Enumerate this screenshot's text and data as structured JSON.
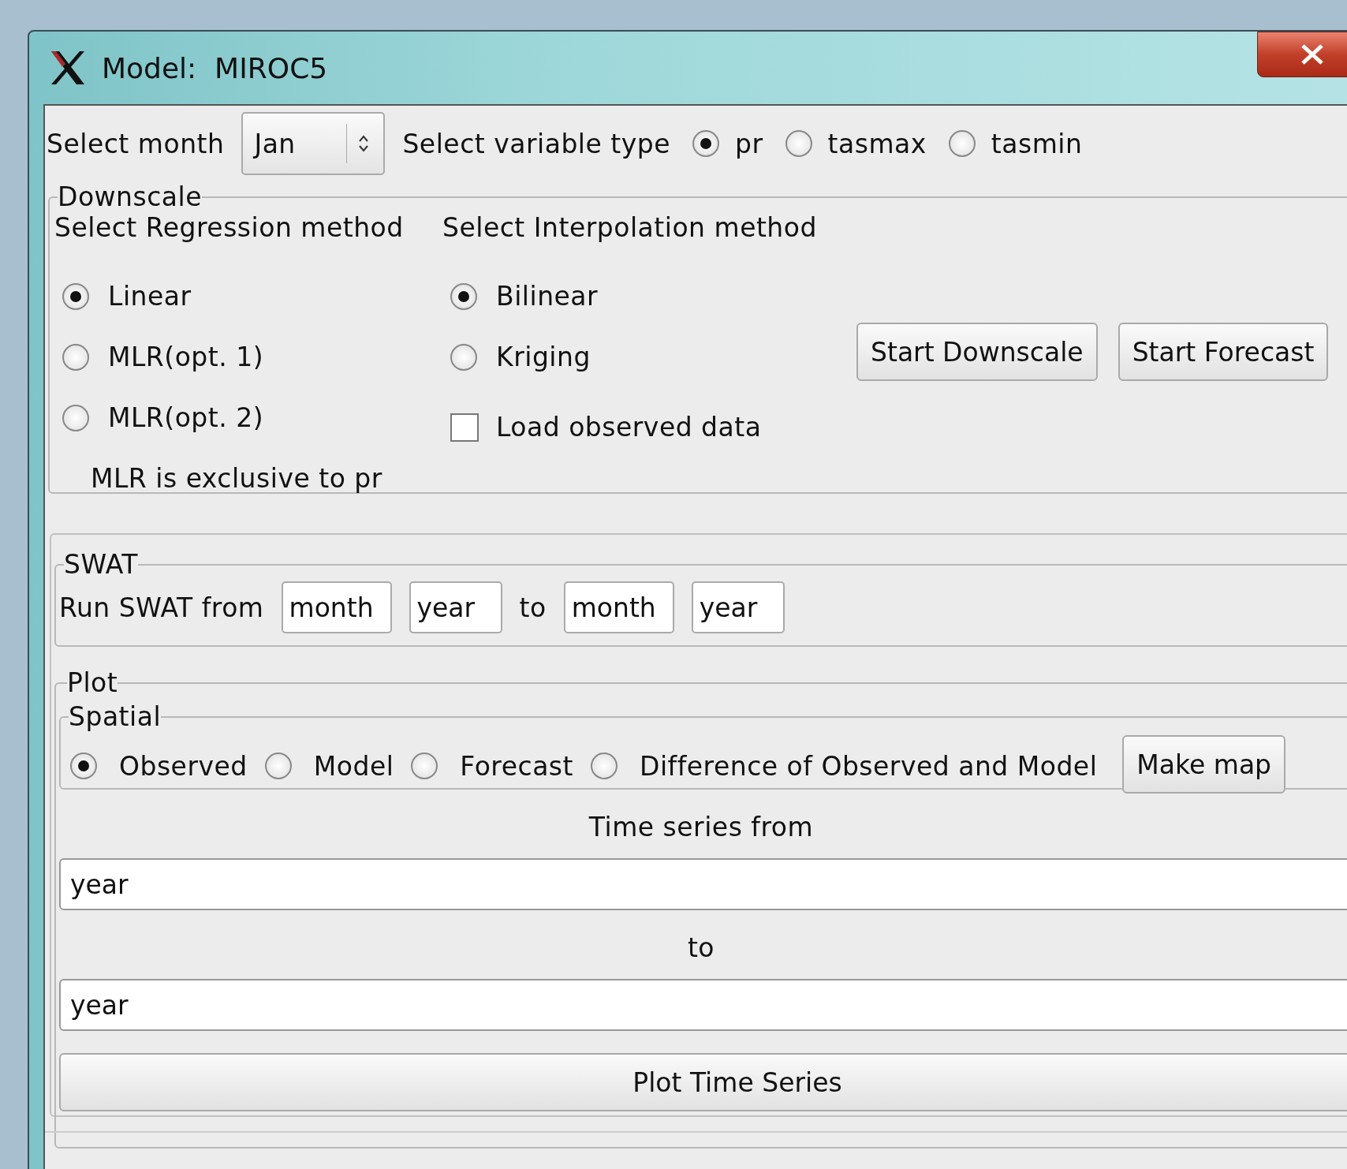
{
  "window": {
    "title": "Model:  MIROC5"
  },
  "month_select": {
    "label": "Select month",
    "value": "Jan"
  },
  "variable_type": {
    "label": "Select variable type",
    "options": [
      {
        "label": "pr",
        "selected": true
      },
      {
        "label": "tasmax",
        "selected": false
      },
      {
        "label": "tasmin",
        "selected": false
      }
    ]
  },
  "downscale": {
    "legend": "Downscale",
    "regression": {
      "label": "Select Regression method",
      "options": [
        {
          "label": "Linear",
          "selected": true
        },
        {
          "label": "MLR(opt. 1)",
          "selected": false
        },
        {
          "label": "MLR(opt. 2)",
          "selected": false
        }
      ]
    },
    "interpolation": {
      "label": "Select Interpolation method",
      "options": [
        {
          "label": "Bilinear",
          "selected": true
        },
        {
          "label": "Kriging",
          "selected": false
        }
      ]
    },
    "load_observed": {
      "label": "Load observed data",
      "checked": false
    },
    "note": "MLR is exclusive to pr",
    "buttons": [
      "Start Downscale",
      "Start Forecast"
    ]
  },
  "swat": {
    "legend": "SWAT",
    "label": "Run SWAT from",
    "from_fields": [
      {
        "value": "month"
      },
      {
        "value": "year"
      }
    ],
    "to_label": "to",
    "to_fields": [
      {
        "value": "month"
      },
      {
        "value": "year"
      }
    ]
  },
  "plot": {
    "legend": "Plot",
    "spatial": {
      "legend": "Spatial",
      "options": [
        {
          "label": "Observed",
          "selected": true
        },
        {
          "label": "Model",
          "selected": false
        },
        {
          "label": "Forecast",
          "selected": false
        },
        {
          "label": "Difference of Observed and Model",
          "selected": false
        }
      ],
      "button": "Make map"
    },
    "time_series_label": "Time series from",
    "from_field": {
      "value": "year"
    },
    "to_label": "to",
    "to_field": {
      "value": "year"
    },
    "button": "Plot Time Series"
  }
}
